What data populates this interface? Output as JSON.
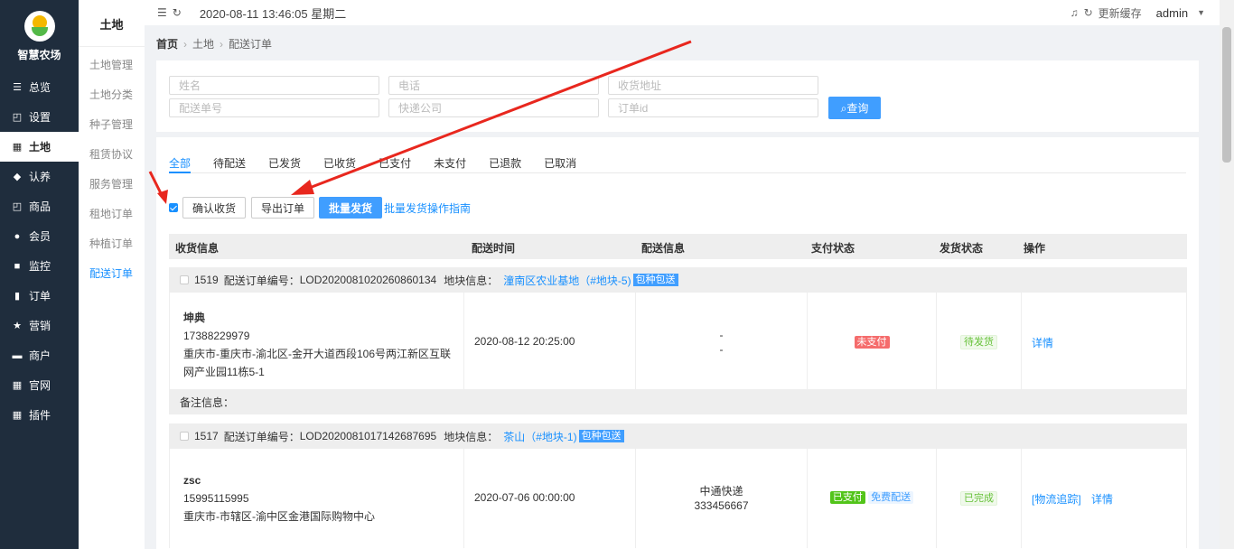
{
  "nav": {
    "logo_text": "智慧农场",
    "items": [
      {
        "label": "总览",
        "icon": "sliders-icon"
      },
      {
        "label": "设置",
        "icon": "bag-icon"
      },
      {
        "label": "土地",
        "icon": "grid-icon"
      },
      {
        "label": "认养",
        "icon": "diamond-icon"
      },
      {
        "label": "商品",
        "icon": "bag-icon"
      },
      {
        "label": "会员",
        "icon": "user-icon"
      },
      {
        "label": "监控",
        "icon": "camera-icon"
      },
      {
        "label": "订单",
        "icon": "clipboard-icon"
      },
      {
        "label": "营销",
        "icon": "star-icon"
      },
      {
        "label": "商户",
        "icon": "shop-icon"
      },
      {
        "label": "官网",
        "icon": "grid-icon"
      },
      {
        "label": "插件",
        "icon": "grid-icon"
      }
    ]
  },
  "sub_nav": {
    "title": "土地",
    "items": [
      "土地管理",
      "土地分类",
      "种子管理",
      "租赁协议",
      "服务管理",
      "租地订单",
      "种植订单",
      "配送订单"
    ]
  },
  "topbar": {
    "datetime": "2020-08-11 13:46:05 星期二",
    "refresh_cache": "更新缓存",
    "user": "admin"
  },
  "breadcrumb": {
    "home": "首页",
    "level1": "土地",
    "current": "配送订单"
  },
  "filter": {
    "name_placeholder": "姓名",
    "phone_placeholder": "电话",
    "address_placeholder": "收货地址",
    "delivery_no_placeholder": "配送单号",
    "express_placeholder": "快递公司",
    "order_id_placeholder": "订单id",
    "query_label": "查询"
  },
  "tabs": [
    "全部",
    "待配送",
    "已发货",
    "已收货",
    "已支付",
    "未支付",
    "已退款",
    "已取消"
  ],
  "actions": {
    "confirm_receipt": "确认收货",
    "export": "导出订单",
    "batch_ship": "批量发货",
    "guide": "批量发货操作指南"
  },
  "table_headers": [
    "收货信息",
    "配送时间",
    "配送信息",
    "支付状态",
    "发货状态",
    "操作"
  ],
  "orders": [
    {
      "id": "1519",
      "order_no_label": "配送订单编号：",
      "order_no": "LOD2020081020260860134",
      "plot_label": "地块信息：",
      "plot": "潼南区农业基地（#地块-5)",
      "badge": "包种包送",
      "name": "坤典",
      "phone": "17388229979",
      "address": "重庆市-重庆市-渝北区-金开大道西段106号两江新区互联网产业园11栋5-1",
      "delivery_time": "2020-08-12 20:25:00",
      "delivery_info_1": "-",
      "delivery_info_2": "-",
      "pay_status": "未支付",
      "ship_status": "待发货",
      "op_detail": "详情",
      "note_label": "备注信息："
    },
    {
      "id": "1517",
      "order_no_label": "配送订单编号：",
      "order_no": "LOD2020081017142687695",
      "plot_label": "地块信息：",
      "plot": "茶山（#地块-1)",
      "badge": "包种包送",
      "name": "zsc",
      "phone": "15995115995",
      "address": "重庆市-市辖区-渝中区金港国际购物中心",
      "delivery_time": "2020-07-06 00:00:00",
      "delivery_info_1": "中通快递",
      "delivery_info_2": "333456667",
      "pay_status": "已支付",
      "pay_extra": "免费配送",
      "ship_status": "已完成",
      "op_track": "[物流追踪]",
      "op_detail": "详情"
    }
  ],
  "colors": {
    "sidebar": "#1f2d3d",
    "primary": "#409eff",
    "annotation_arrow": "#e8271e"
  }
}
